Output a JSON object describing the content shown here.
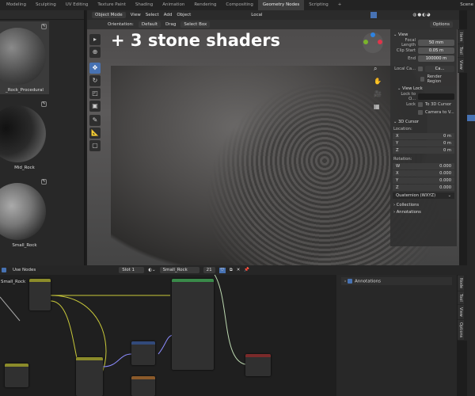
{
  "workspaces": [
    "Modeling",
    "Sculpting",
    "UV Editing",
    "Texture Paint",
    "Shading",
    "Animation",
    "Rendering",
    "Compositing",
    "Geometry Nodes",
    "Scripting",
    "+"
  ],
  "active_workspace": "Geometry Nodes",
  "scene": "Scene",
  "assets": [
    {
      "name": "_Rock_Procedural"
    },
    {
      "name": "Mid_Rock"
    },
    {
      "name": "Small_Rock"
    }
  ],
  "viewport": {
    "mode": "Object Mode",
    "menus": [
      "View",
      "Select",
      "Add",
      "Object"
    ],
    "transform": "Local",
    "orientation_label": "Orientation:",
    "orientation": "Default",
    "drag_label": "Drag",
    "drag": "Select Box",
    "options": "Options",
    "overlay_text": "+ 3 stone shaders"
  },
  "npanel": {
    "view": "View",
    "focal_label": "Focal Length",
    "focal": "50 mm",
    "clip_start_label": "Clip Start",
    "clip_start": "0.05 m",
    "end_label": "End",
    "end": "100000 m",
    "local_cam_label": "Local Ca...",
    "local_cam": "Ca...",
    "render_region": "Render Region",
    "view_lock": "View Lock",
    "lock_to_label": "Lock to O...",
    "lock_label": "Lock",
    "to_cursor": "To 3D Cursor",
    "camera_to_view": "Camera to V...",
    "cursor": "3D Cursor",
    "location": "Location:",
    "rotation": "Rotation:",
    "loc": [
      [
        "X",
        "0 m"
      ],
      [
        "Y",
        "0 m"
      ],
      [
        "Z",
        "0 m"
      ]
    ],
    "rot": [
      [
        "W",
        "0.000"
      ],
      [
        "X",
        "0.000"
      ],
      [
        "Y",
        "0.000"
      ],
      [
        "Z",
        "0.000"
      ]
    ],
    "rot_mode": "Quaternion (WXYZ)",
    "collections": "Collections",
    "annotations": "Annotations"
  },
  "viewport_tabs": [
    "Item",
    "Tool",
    "View"
  ],
  "node_editor": {
    "use_nodes": "Use Nodes",
    "slot": "Slot 1",
    "material": "Small_Rock",
    "users": "21",
    "frame_label": "Small_Rock",
    "annotations": "Annotations",
    "tabs": [
      "Node",
      "Tool",
      "View",
      "Options"
    ]
  }
}
